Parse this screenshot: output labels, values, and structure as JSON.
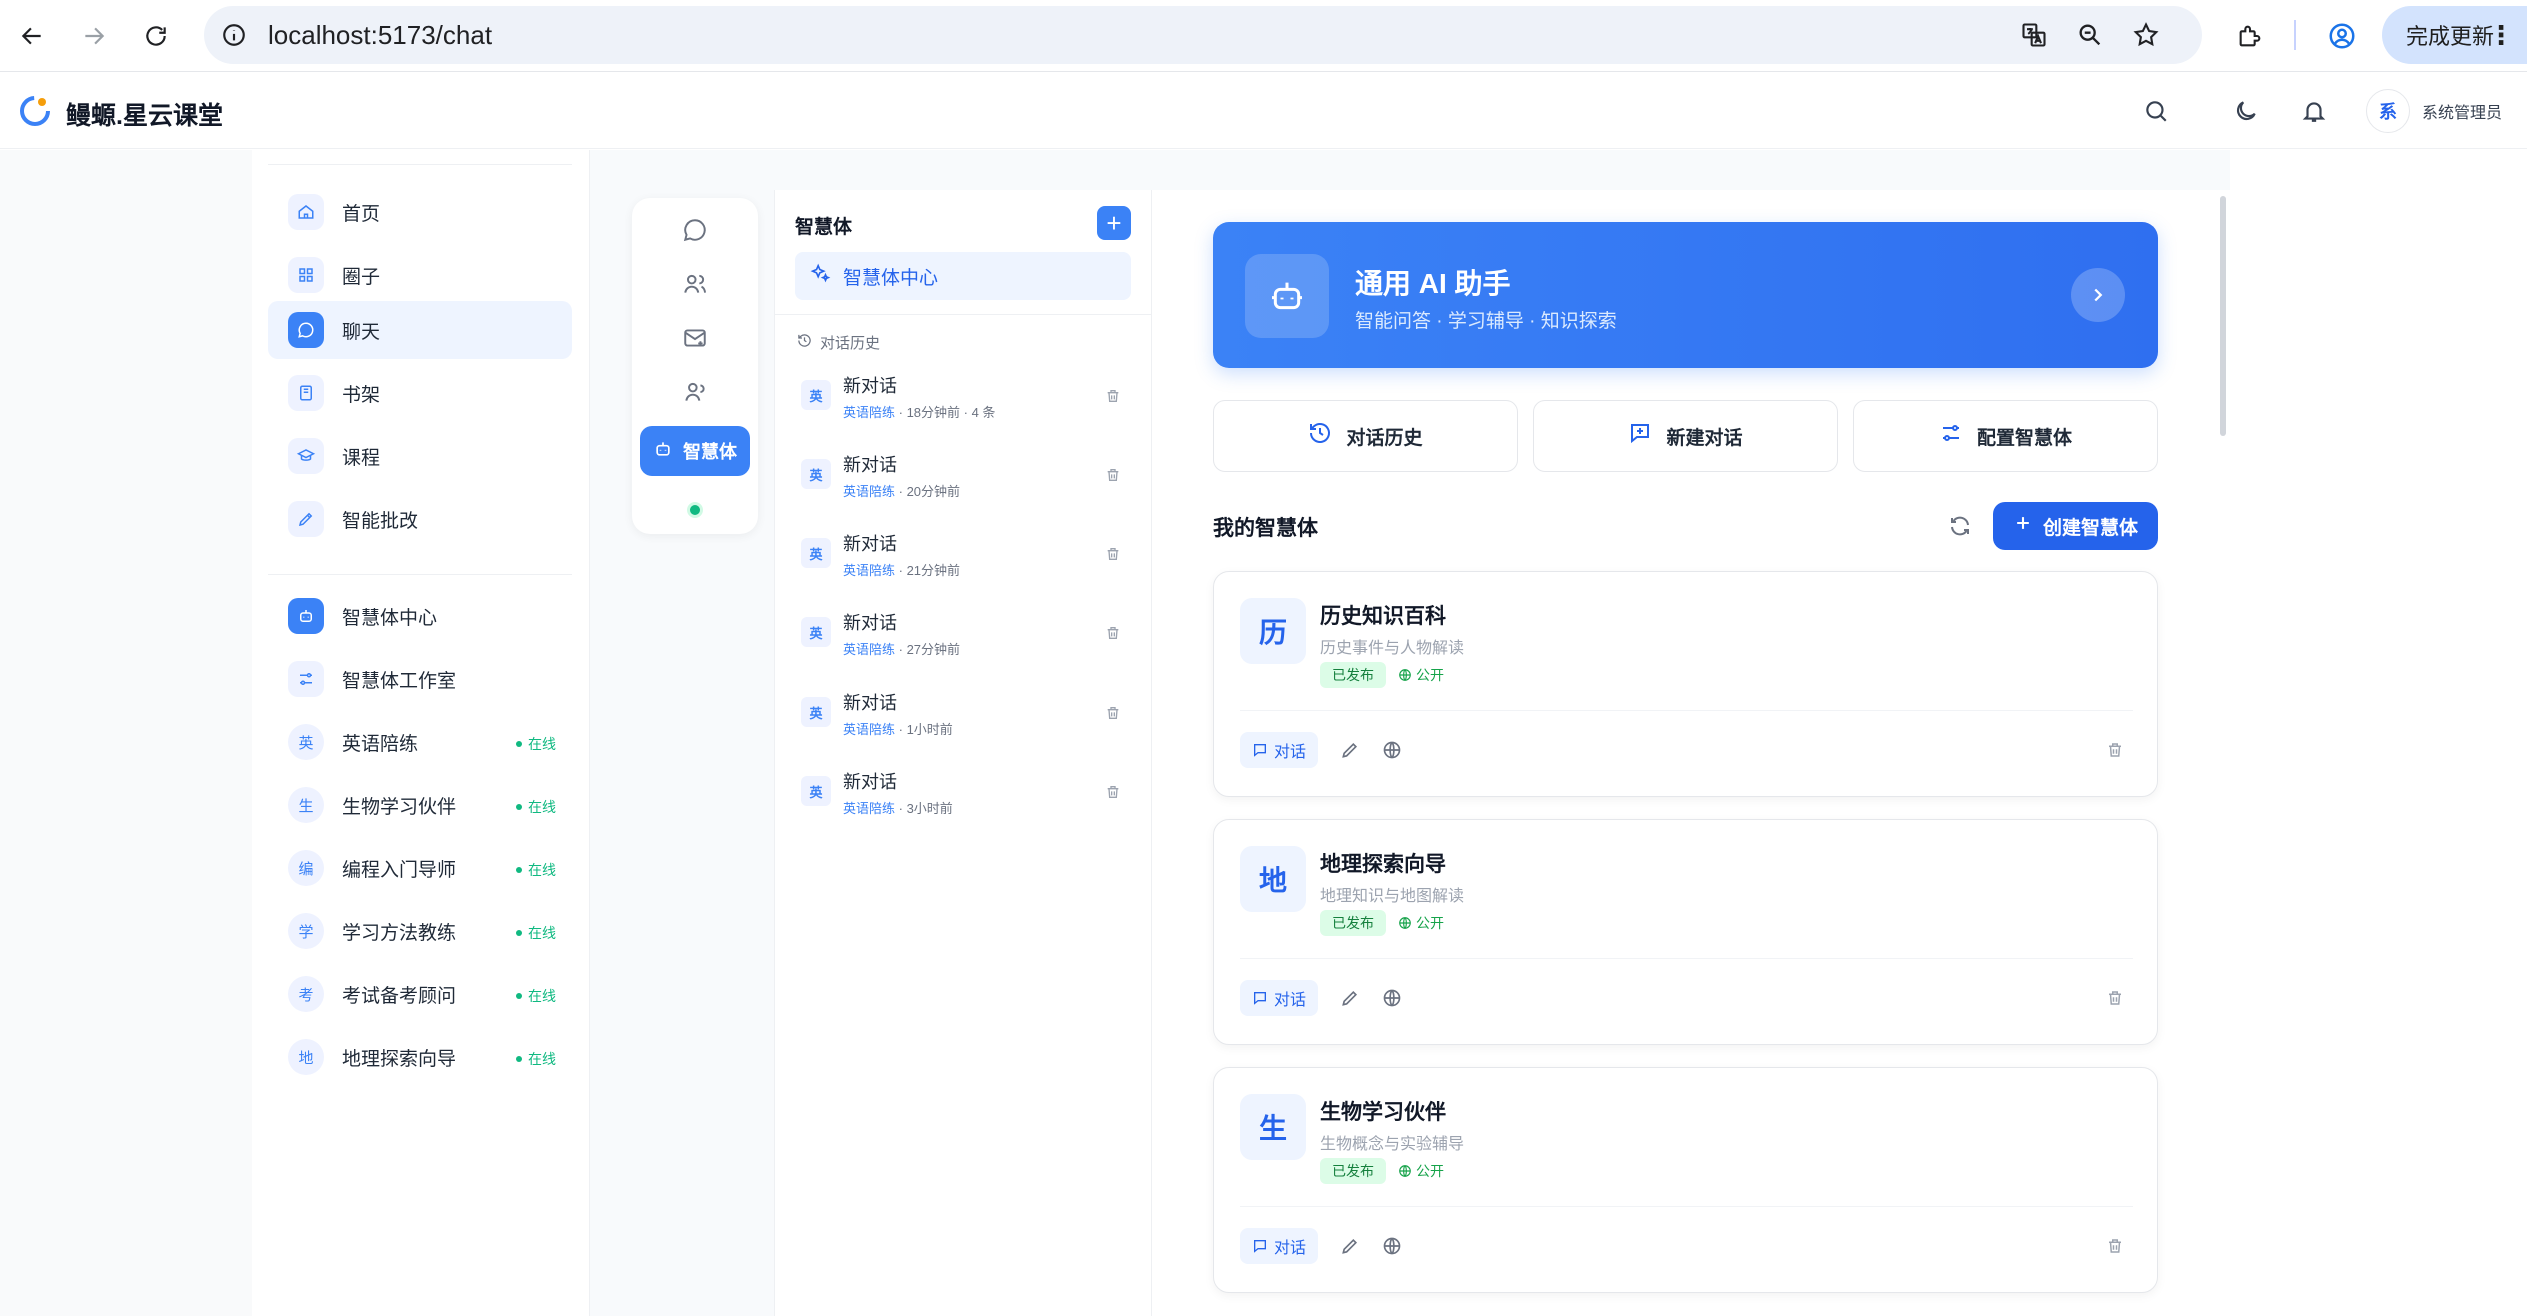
{
  "browser": {
    "url": "localhost:5173/chat",
    "update_label": "完成更新",
    "menu_glyph": "⋮"
  },
  "header": {
    "brand": "鳗螈.星云课堂",
    "user_avatar": "系",
    "user_name": "系统管理员"
  },
  "sidebar": {
    "main_items": [
      {
        "label": "首页",
        "icon": "home-icon"
      },
      {
        "label": "圈子",
        "icon": "grid-icon"
      },
      {
        "label": "聊天",
        "icon": "chat-icon"
      },
      {
        "label": "书架",
        "icon": "book-icon"
      },
      {
        "label": "课程",
        "icon": "graduation-cap-icon"
      },
      {
        "label": "智能批改",
        "icon": "pen-icon"
      }
    ],
    "agent_items": [
      {
        "label": "智慧体中心",
        "icon": "robot-icon"
      },
      {
        "label": "智慧体工作室",
        "icon": "sliders-icon"
      }
    ],
    "bots": [
      {
        "avatar": "英",
        "label": "英语陪练",
        "status": "在线"
      },
      {
        "avatar": "生",
        "label": "生物学习伙伴",
        "status": "在线"
      },
      {
        "avatar": "编",
        "label": "编程入门导师",
        "status": "在线"
      },
      {
        "avatar": "学",
        "label": "学习方法教练",
        "status": "在线"
      },
      {
        "avatar": "考",
        "label": "考试备考顾问",
        "status": "在线"
      },
      {
        "avatar": "地",
        "label": "地理探索向导",
        "status": "在线"
      }
    ]
  },
  "rail": {
    "active_label": "智慧体"
  },
  "conversations": {
    "title": "智慧体",
    "add_label": "+",
    "center_label": "智慧体中心",
    "history_label": "对话历史",
    "items": [
      {
        "badge": "英",
        "title": "新对话",
        "tag": "英语陪练",
        "meta": " · 18分钟前 · 4 条"
      },
      {
        "badge": "英",
        "title": "新对话",
        "tag": "英语陪练",
        "meta": " · 20分钟前"
      },
      {
        "badge": "英",
        "title": "新对话",
        "tag": "英语陪练",
        "meta": " · 21分钟前"
      },
      {
        "badge": "英",
        "title": "新对话",
        "tag": "英语陪练",
        "meta": " · 27分钟前"
      },
      {
        "badge": "英",
        "title": "新对话",
        "tag": "英语陪练",
        "meta": " · 1小时前"
      },
      {
        "badge": "英",
        "title": "新对话",
        "tag": "英语陪练",
        "meta": " · 3小时前"
      }
    ]
  },
  "hero": {
    "title": "通用 AI 助手",
    "subtitle": "智能问答 · 学习辅导 · 知识探索"
  },
  "quick_actions": [
    {
      "label": "对话历史",
      "icon": "history-icon"
    },
    {
      "label": "新建对话",
      "icon": "new-chat-icon"
    },
    {
      "label": "配置智慧体",
      "icon": "sliders-icon"
    }
  ],
  "my_agents": {
    "title": "我的智慧体",
    "create_label": "创建智慧体",
    "cards": [
      {
        "avatar": "历",
        "name": "历史知识百科",
        "desc": "历史事件与人物解读",
        "status": "已发布",
        "visibility": "公开",
        "chat_label": "对话"
      },
      {
        "avatar": "地",
        "name": "地理探索向导",
        "desc": "地理知识与地图解读",
        "status": "已发布",
        "visibility": "公开",
        "chat_label": "对话"
      },
      {
        "avatar": "生",
        "name": "生物学习伙伴",
        "desc": "生物概念与实验辅导",
        "status": "已发布",
        "visibility": "公开",
        "chat_label": "对话"
      }
    ]
  },
  "colors": {
    "accent": "#3b82f6",
    "online": "#10b981"
  }
}
